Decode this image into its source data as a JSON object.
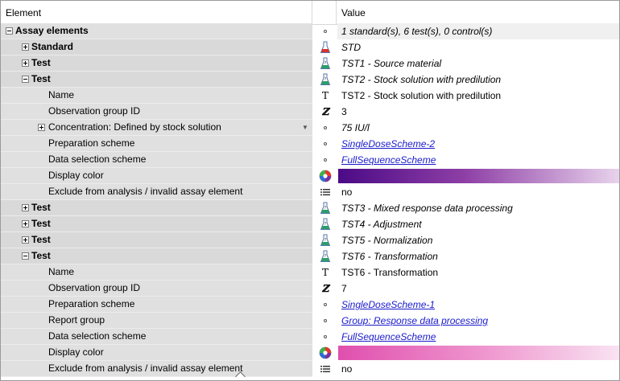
{
  "header": {
    "element_label": "Element",
    "value_label": "Value"
  },
  "colors": {
    "std_icon": "#d9342b",
    "test_icon": "#2e9e68",
    "link": "#1a1acc",
    "tst2_color_bar": [
      "#4b0a86",
      "#e8d3ec"
    ],
    "tst6_color_bar": [
      "#e04fae",
      "#f9e3f2"
    ]
  },
  "rows": [
    {
      "label": "Assay elements",
      "value": "1 standard(s), 6 test(s), 0 control(s)",
      "icon": "dot-icon"
    },
    {
      "label": "Standard",
      "value": "STD",
      "icon": "flask-red-icon"
    },
    {
      "label": "Test",
      "value": "TST1 - Source material",
      "icon": "flask-green-icon"
    },
    {
      "label": "Test",
      "value": "TST2 - Stock solution with predilution",
      "icon": "flask-green-icon"
    },
    {
      "label": "Name",
      "value": "TST2 - Stock solution with predilution",
      "icon": "text-icon"
    },
    {
      "label": "Observation group ID",
      "value": "3",
      "icon": "integer-icon"
    },
    {
      "label": "Concentration: Defined by stock solution",
      "value": "75 IU/l",
      "icon": "dot-icon"
    },
    {
      "label": "Preparation scheme",
      "value": "SingleDoseScheme-2",
      "icon": "dot-icon"
    },
    {
      "label": "Data selection scheme",
      "value": "FullSequenceScheme",
      "icon": "dot-icon"
    },
    {
      "label": "Display color",
      "value": "",
      "icon": "color-wheel-icon"
    },
    {
      "label": "Exclude from analysis / invalid assay element",
      "value": "no",
      "icon": "list-icon"
    },
    {
      "label": "Test",
      "value": "TST3 - Mixed response data processing",
      "icon": "flask-green-icon"
    },
    {
      "label": "Test",
      "value": "TST4 - Adjustment",
      "icon": "flask-green-icon"
    },
    {
      "label": "Test",
      "value": "TST5 - Normalization",
      "icon": "flask-green-icon"
    },
    {
      "label": "Test",
      "value": "TST6 - Transformation",
      "icon": "flask-green-icon"
    },
    {
      "label": "Name",
      "value": "TST6 - Transformation",
      "icon": "text-icon"
    },
    {
      "label": "Observation group ID",
      "value": "7",
      "icon": "integer-icon"
    },
    {
      "label": "Preparation scheme",
      "value": "SingleDoseScheme-1",
      "icon": "dot-icon"
    },
    {
      "label": "Report group",
      "value": "Group: Response data processing",
      "icon": "dot-icon"
    },
    {
      "label": "Data selection scheme",
      "value": "FullSequenceScheme",
      "icon": "dot-icon"
    },
    {
      "label": "Display color",
      "value": "",
      "icon": "color-wheel-icon"
    },
    {
      "label": "Exclude from analysis / invalid assay element",
      "value": "no",
      "icon": "list-icon"
    }
  ]
}
